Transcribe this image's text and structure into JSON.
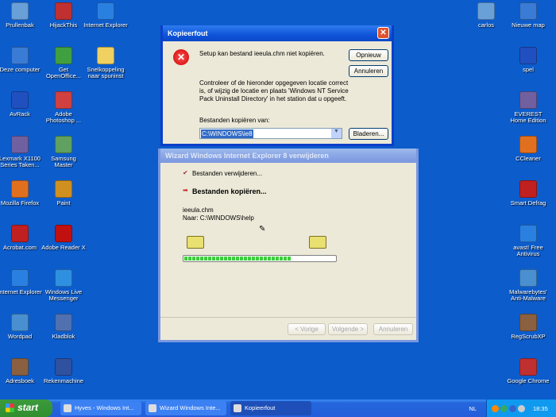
{
  "desktop": {
    "icons_left": [
      [
        "Prullenbak",
        "Deze computer",
        "AvRack",
        "Lexmark X1100 Series Taken...",
        "Mozilla Firefox",
        "Acrobat.com",
        "Internet Explorer",
        "Wordpad",
        "Adresboek"
      ],
      [
        "HijackThis",
        "Get OpenOffice...",
        "Adobe Photoshop ...",
        "Samsung Master",
        "Paint",
        "Adobe Reader X",
        "Windows Live Messenger",
        "Kladblok",
        "Rekenmachine"
      ],
      [
        "Internet Explorer",
        "Snelkoppeling naar spuninst"
      ]
    ],
    "icons_right": [
      [
        "carlos"
      ],
      [
        "Nieuwe map",
        "spel",
        "EVEREST Home Edition",
        "CCleaner",
        "Smart Defrag",
        "avast! Free Antivirus",
        "Malwarebytes' Anti-Malware",
        "RegScrubXP",
        "Google Chrome"
      ]
    ]
  },
  "error_dialog": {
    "title": "Kopieerfout",
    "message": "Setup kan bestand ieeula.chm niet kopiëren.",
    "instructions": "Controleer of de hieronder opgegeven locatie correct is, of wijzig de locatie en plaats 'Windows NT Service Pack Uninstall Directory' in het station dat u opgeeft.",
    "source_label": "Bestanden kopiëren van:",
    "source_value": "C:\\WINDOWS\\ie8",
    "retry": "Opnieuw",
    "cancel": "Annuleren",
    "browse": "Bladeren..."
  },
  "wizard": {
    "title": "Wizard Windows Internet Explorer 8 verwijderen",
    "step1": "Bestanden verwijderen...",
    "step2": "Bestanden kopiëren...",
    "file": "ieeula.chm",
    "dest": "Naar: C:\\WINDOWS\\help",
    "progress": 0.71,
    "back": "< Vorige",
    "next": "Volgende >",
    "cancel": "Annuleren"
  },
  "taskbar": {
    "start": "start",
    "tasks": [
      "Hyves - Windows Int...",
      "Wizard Windows Inte...",
      "Kopieerfout"
    ],
    "lang": "NL",
    "clock": "18:35"
  },
  "colors": {
    "desktop": "#0c5ccc",
    "icon_colors": [
      "#6aa0d8",
      "#3a7bd5",
      "#2050c0",
      "#7060a0",
      "#e07020",
      "#c02020",
      "#2a80e0",
      "#4a90d0",
      "#8a6040",
      "#c03030",
      "#40a040",
      "#d04040",
      "#60a060",
      "#d09020",
      "#c01010",
      "#3090e0",
      "#5070b0",
      "#3050a0",
      "#2a80e0",
      "#f0d060"
    ]
  }
}
